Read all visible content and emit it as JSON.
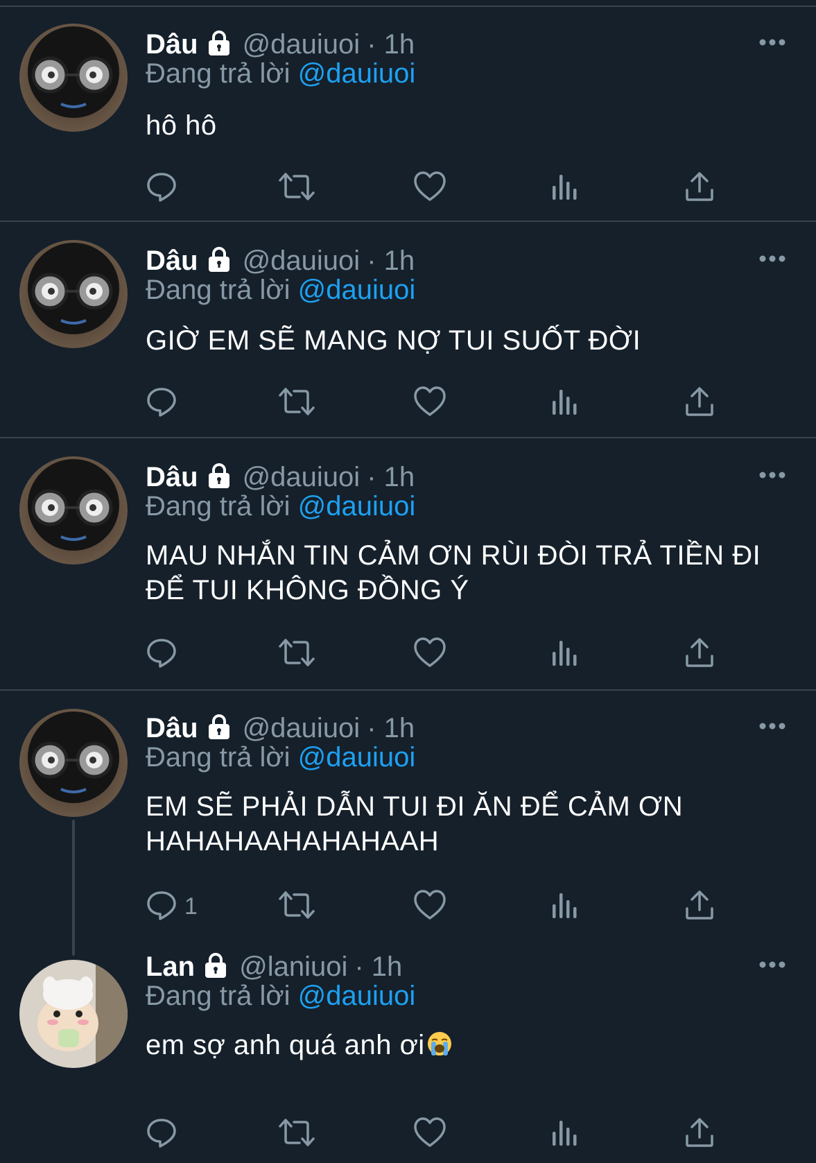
{
  "tweets": [
    {
      "name": "Dâu",
      "handle": "@dauiuoi",
      "time": "· 1h",
      "reply_prefix": "Đang trả lời",
      "reply_to": "@dauiuoi",
      "text": "hô hô",
      "reply_count": ""
    },
    {
      "name": "Dâu",
      "handle": "@dauiuoi",
      "time": "· 1h",
      "reply_prefix": "Đang trả lời",
      "reply_to": "@dauiuoi",
      "text": "GIỜ EM SẼ MANG NỢ TUI SUỐT ĐỜI",
      "reply_count": ""
    },
    {
      "name": "Dâu",
      "handle": "@dauiuoi",
      "time": "· 1h",
      "reply_prefix": "Đang trả lời",
      "reply_to": "@dauiuoi",
      "text_line1": "MAU NHẮN TIN CẢM ƠN RÙI ĐÒI TRẢ TIỀN ĐI",
      "text_line2": "ĐỂ TUI KHÔNG ĐỒNG Ý",
      "reply_count": ""
    },
    {
      "name": "Dâu",
      "handle": "@dauiuoi",
      "time": "· 1h",
      "reply_prefix": "Đang trả lời",
      "reply_to": "@dauiuoi",
      "text_line1": "EM SẼ PHẢI DẪN TUI ĐI ĂN ĐỂ CẢM ƠN",
      "text_line2": "HAHAHAAHAHAHAAH",
      "reply_count": "1"
    },
    {
      "name": "Lan",
      "handle": "@laniuoi",
      "time": "· 1h",
      "reply_prefix": "Đang trả lời",
      "reply_to": "@dauiuoi",
      "text": "em sợ anh quá anh ơi",
      "emoji": "loudly-crying-face",
      "reply_count": ""
    }
  ],
  "colors": {
    "background": "#15202b",
    "divider": "#38444d",
    "secondary_text": "#8899a6",
    "link": "#1da1f2"
  },
  "icons": {
    "lock": "lock-icon",
    "more": "more-icon",
    "reply": "reply-icon",
    "retweet": "retweet-icon",
    "like": "heart-icon",
    "views": "analytics-icon",
    "share": "share-icon"
  }
}
